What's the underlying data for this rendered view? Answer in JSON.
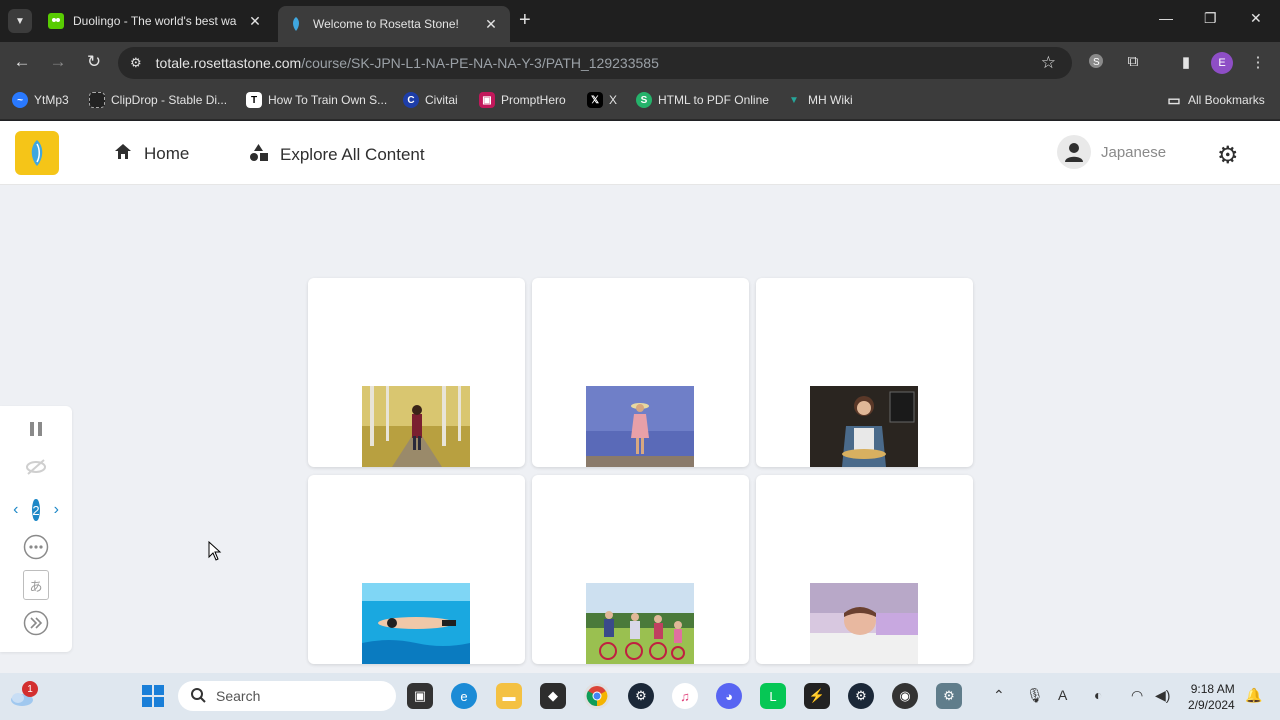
{
  "browser": {
    "tabs": [
      {
        "title": "Duolingo - The world's best wa",
        "favicon": "duolingo-icon",
        "active": false
      },
      {
        "title": "Welcome to Rosetta Stone!",
        "favicon": "rosetta-stone-icon",
        "active": true
      }
    ],
    "url_host": "totale.rosettastone.com",
    "url_path": "/course/SK-JPN-L1-NA-PE-NA-NA-Y-3/PATH_129233585",
    "profile_initial": "E",
    "bookmarks": [
      {
        "label": "YtMp3",
        "icon": "ytmp3-icon",
        "color": "#2979ff"
      },
      {
        "label": "ClipDrop - Stable Di...",
        "icon": "clipdrop-icon",
        "color": "#222222"
      },
      {
        "label": "How To Train Own S...",
        "icon": "t-icon",
        "color": "#ffffff"
      },
      {
        "label": "Civitai",
        "icon": "civitai-icon",
        "color": "#1e3ea8"
      },
      {
        "label": "PromptHero",
        "icon": "prompthero-icon",
        "color": "#c2185b"
      },
      {
        "label": "X",
        "icon": "x-icon",
        "color": "#000000"
      },
      {
        "label": "HTML to PDF Online",
        "icon": "html-to-pdf-icon",
        "color": "#25b36b"
      },
      {
        "label": "MH Wiki",
        "icon": "mh-wiki-icon",
        "color": "#26a69a"
      }
    ],
    "all_bookmarks": "All Bookmarks"
  },
  "app": {
    "nav": {
      "home": "Home",
      "explore": "Explore All Content"
    },
    "user_language": "Japanese",
    "accent": "#1e88c7",
    "logo_color": "#f5c518"
  },
  "cards": [
    {
      "image": "woman-walking-autumn-forest"
    },
    {
      "image": "girl-in-hat-on-beach"
    },
    {
      "image": "woman-serving-food-restaurant"
    },
    {
      "image": "swimmer-underwater"
    },
    {
      "image": "children-on-bicycles"
    },
    {
      "image": "boy-sleeping-on-pillow"
    }
  ],
  "side_panel": {
    "page": "2",
    "buttons": [
      "pause-icon",
      "hide-icon",
      "more-icon",
      "kana-icon",
      "skip-icon"
    ],
    "kana_glyph": "あ"
  },
  "taskbar": {
    "search_placeholder": "Search",
    "notification_count": "1",
    "time": "9:18 AM",
    "date": "2/9/2024"
  }
}
